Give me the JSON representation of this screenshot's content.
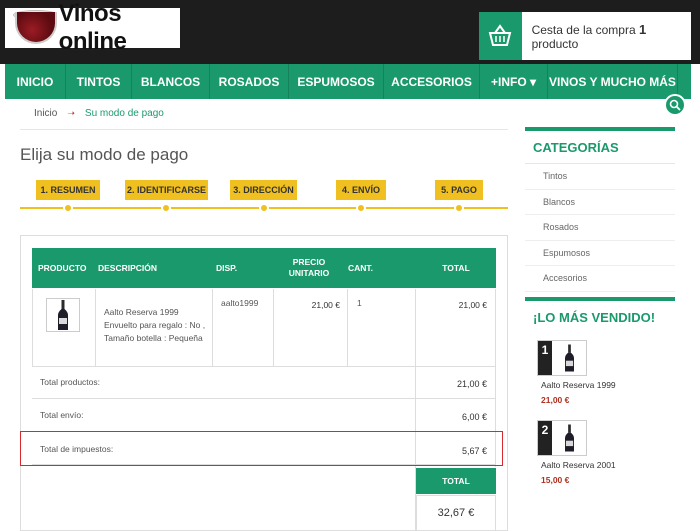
{
  "header": {
    "logo_text": "Vinos online",
    "cart_prefix": "Cesta de la compra",
    "cart_count": "1",
    "cart_suffix": "producto"
  },
  "nav": {
    "items": [
      "INICIO",
      "TINTOS",
      "BLANCOS",
      "ROSADOS",
      "ESPUMOSOS",
      "ACCESORIOS",
      "+INFO ▾",
      "VINOS Y MUCHO MÁS"
    ]
  },
  "breadcrumb": {
    "home": "Inicio",
    "current": "Su modo de pago"
  },
  "page": {
    "title": "Elija su modo de pago"
  },
  "steps": [
    "1. RESUMEN",
    "2. IDENTIFICARSE",
    "3. DIRECCIÓN",
    "4. ENVÍO",
    "5. PAGO"
  ],
  "table": {
    "headers": [
      "PRODUCTO",
      "DESCRIPCIÓN",
      "DISP.",
      "PRECIO UNITARIO",
      "CANT.",
      "TOTAL"
    ],
    "row": {
      "description": "Aalto Reserva 1999 Envuelto para regalo : No , Tamaño botella : Pequeña",
      "ref": "aalto1999",
      "unit_price": "21,00 €",
      "qty": "1",
      "total": "21,00 €"
    },
    "summary": [
      {
        "label": "Total productos:",
        "value": "21,00 €"
      },
      {
        "label": "Total envío:",
        "value": "6,00 €"
      },
      {
        "label": "Total de impuestos:",
        "value": "5,67 €"
      }
    ],
    "total_label": "TOTAL",
    "total_value": "32,67 €"
  },
  "sidebar": {
    "categories_title": "CATEGORÍAS",
    "categories": [
      "Tintos",
      "Blancos",
      "Rosados",
      "Espumosos",
      "Accesorios"
    ],
    "bestsellers_title": "¡LO MÁS VENDIDO!",
    "bestsellers": [
      {
        "rank": "1",
        "name": "Aalto Reserva 1999",
        "price": "21,00 €"
      },
      {
        "rank": "2",
        "name": "Aalto Reserva 2001",
        "price": "15,00 €"
      }
    ]
  },
  "colors": {
    "accent": "#1a9a6c",
    "step": "#f0c020",
    "highlight": "#d9282e",
    "header_bg": "#1d1d1d"
  }
}
